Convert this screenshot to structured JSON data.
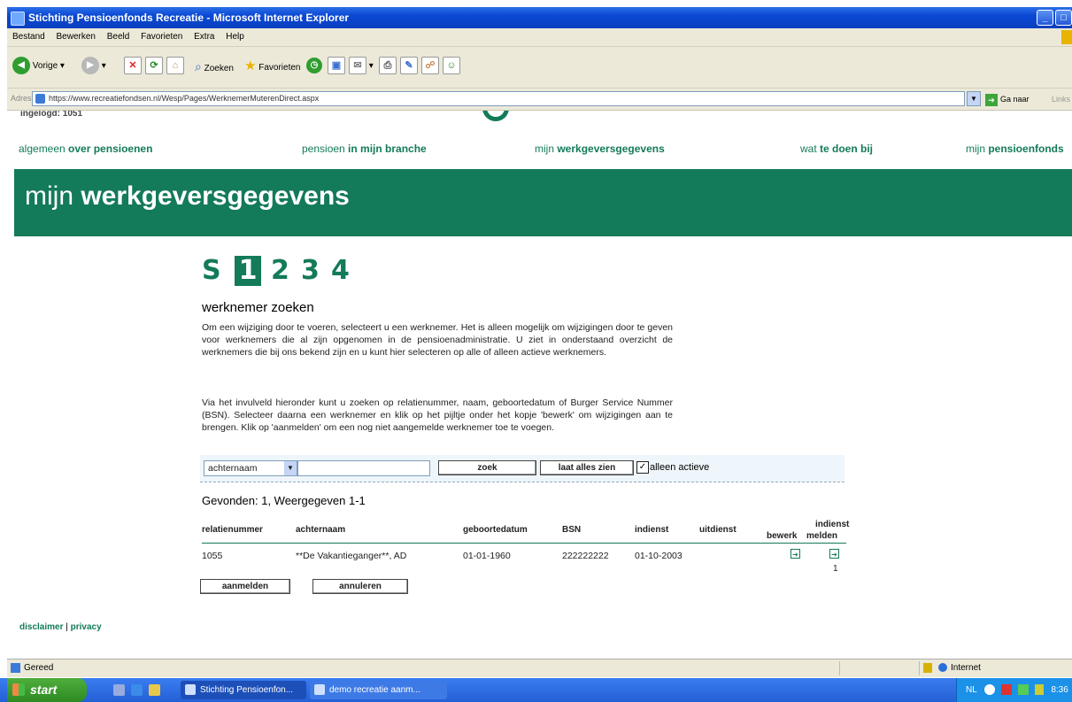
{
  "window": {
    "title": "Stichting Pensioenfonds Recreatie - Microsoft Internet Explorer",
    "controls": [
      "_",
      "□"
    ]
  },
  "menu": [
    "Bestand",
    "Bewerken",
    "Beeld",
    "Favorieten",
    "Extra",
    "Help"
  ],
  "toolbar": {
    "back": "Vorige",
    "search": "Zoeken",
    "favorites": "Favorieten"
  },
  "address": {
    "label": "Adres",
    "url": "https://www.recreatiefondsen.nl/Wesp/Pages/WerknemerMuterenDirect.aspx",
    "go": "Ga naar",
    "links": "Links"
  },
  "page": {
    "cutoff_text": "ingelogd: 1051",
    "nav": [
      {
        "pre": "algemeen ",
        "bold": "over pensioenen"
      },
      {
        "pre": "pensioen ",
        "bold": "in mijn branche"
      },
      {
        "pre": "mijn ",
        "bold": "werkgeversgegevens"
      },
      {
        "pre": "wat ",
        "bold": "te doen bij"
      },
      {
        "pre": "mijn ",
        "bold": "pensioenfonds"
      }
    ],
    "banner": {
      "pre": "mijn ",
      "bold": "werkgeversgegevens"
    },
    "steps": [
      "S",
      "1",
      "2",
      "3",
      "4"
    ],
    "active_step": "1",
    "section_title": "werknemer zoeken",
    "para1": "Om een wijziging door te voeren, selecteert u een werknemer. Het is alleen mogelijk om wijzigingen door te geven voor werknemers die al zijn opgenomen in de pensioenadministratie. U ziet in onderstaand overzicht de werknemers die bij ons bekend zijn en u kunt hier selecteren op alle of alleen actieve werknemers.",
    "para2": "Via het invulveld hieronder kunt u zoeken op relatienummer, naam, geboortedatum of Burger Service Nummer (BSN). Selecteer daarna een werknemer en klik op het pijltje onder het kopje 'bewerk' om wijzigingen aan te brengen. Klik op 'aanmelden' om een nog niet aangemelde werknemer toe te voegen.",
    "search": {
      "select_value": "achternaam",
      "input_value": "",
      "search_button": "zoek",
      "show_all_button": "laat alles zien",
      "checkbox_checked": true,
      "checkbox_label": "alleen actieve"
    },
    "found": "Gevonden: 1, Weergegeven 1-1",
    "table": {
      "headers": {
        "relatienummer": "relatienummer",
        "achternaam": "achternaam",
        "geboortedatum": "geboortedatum",
        "bsn": "BSN",
        "indienst": "indienst",
        "uitdienst": "uitdienst",
        "bewerk": "bewerk",
        "indienst_melden_1": "indienst",
        "indienst_melden_2": "melden"
      },
      "rows": [
        {
          "relatienummer": "1055",
          "achternaam": "**De Vakantieganger**, AD",
          "geboortedatum": "01-01-1960",
          "bsn": "222222222",
          "indienst": "01-10-2003",
          "uitdienst": "",
          "melden_count": "1"
        }
      ]
    },
    "buttons": {
      "aanmelden": "aanmelden",
      "annuleren": "annuleren"
    },
    "footer": {
      "disclaimer": "disclaimer",
      "separator": "|",
      "privacy": "privacy"
    }
  },
  "status": {
    "text": "Gereed",
    "zone": "Internet"
  },
  "taskbar": {
    "start": "start",
    "tasks": [
      "Stichting Pensioenfon...",
      "demo recreatie aanm..."
    ],
    "tray_lang": "NL",
    "tray_time": "8:36"
  },
  "colors": {
    "brand_green": "#137a5a",
    "xp_blue": "#0a48d4",
    "chrome": "#ece9d8"
  }
}
